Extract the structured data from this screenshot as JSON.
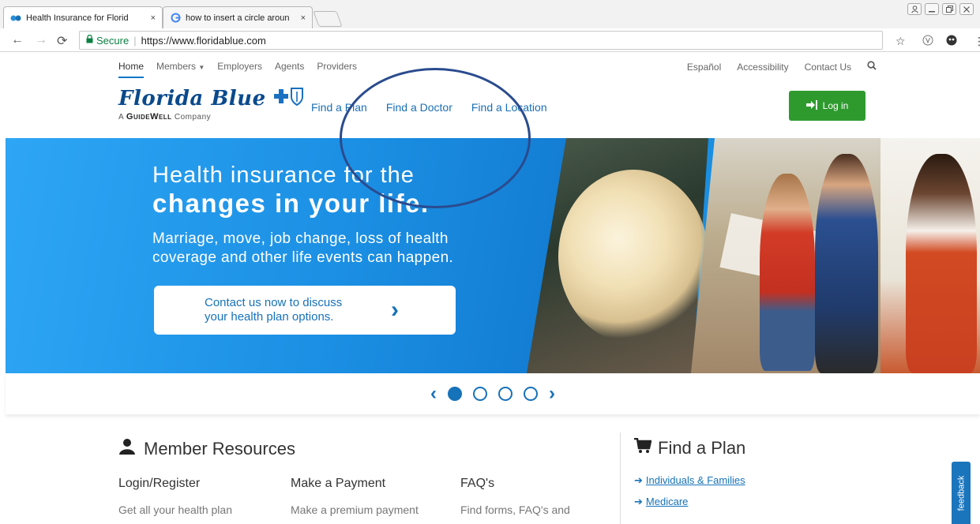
{
  "browser": {
    "tabs": [
      {
        "title": "Health Insurance for Florid",
        "icon": "florida-blue-favicon"
      },
      {
        "title": "how to insert a circle aroun",
        "icon": "google-favicon"
      }
    ],
    "tab_close_glyph": "×",
    "window_controls": [
      "user-icon",
      "minimize-icon",
      "restore-icon",
      "close-icon"
    ],
    "secure_label": "Secure",
    "url": "https://www.floridablue.com"
  },
  "topnav": {
    "left": [
      "Home",
      "Members",
      "Employers",
      "Agents",
      "Providers"
    ],
    "right": [
      "Español",
      "Accessibility",
      "Contact Us"
    ]
  },
  "header": {
    "brand": "Florida Blue",
    "tag_prefix": "A",
    "tag_brand": "GuideWell",
    "tag_suffix": "Company",
    "nav": [
      "Find a Plan",
      "Find a Doctor",
      "Find a Location"
    ],
    "login": "Log in"
  },
  "hero": {
    "line1": "Health insurance for the",
    "line2": "changes in your life.",
    "para_line1": "Marriage, move, job change, loss of health",
    "para_line2": "coverage and other life events can happen.",
    "cta_line1": "Contact us now to discuss",
    "cta_line2": "your health plan options.",
    "cta_chevron": "›"
  },
  "carousel": {
    "prev": "‹",
    "next": "›",
    "count": 4,
    "active": 0
  },
  "member_resources": {
    "title": "Member Resources",
    "columns": [
      {
        "heading": "Login/Register",
        "text": "Get all your health plan"
      },
      {
        "heading": "Make a Payment",
        "text": "Make a premium payment"
      },
      {
        "heading": "FAQ's",
        "text": "Find forms, FAQ's and"
      }
    ]
  },
  "find_plan": {
    "title": "Find a Plan",
    "links": [
      "Individuals & Families",
      "Medicare"
    ]
  },
  "feedback": "feedback",
  "colors": {
    "brand_blue": "#1672b9",
    "login_green": "#2e9a2e",
    "annotation": "#2a4b8e"
  }
}
